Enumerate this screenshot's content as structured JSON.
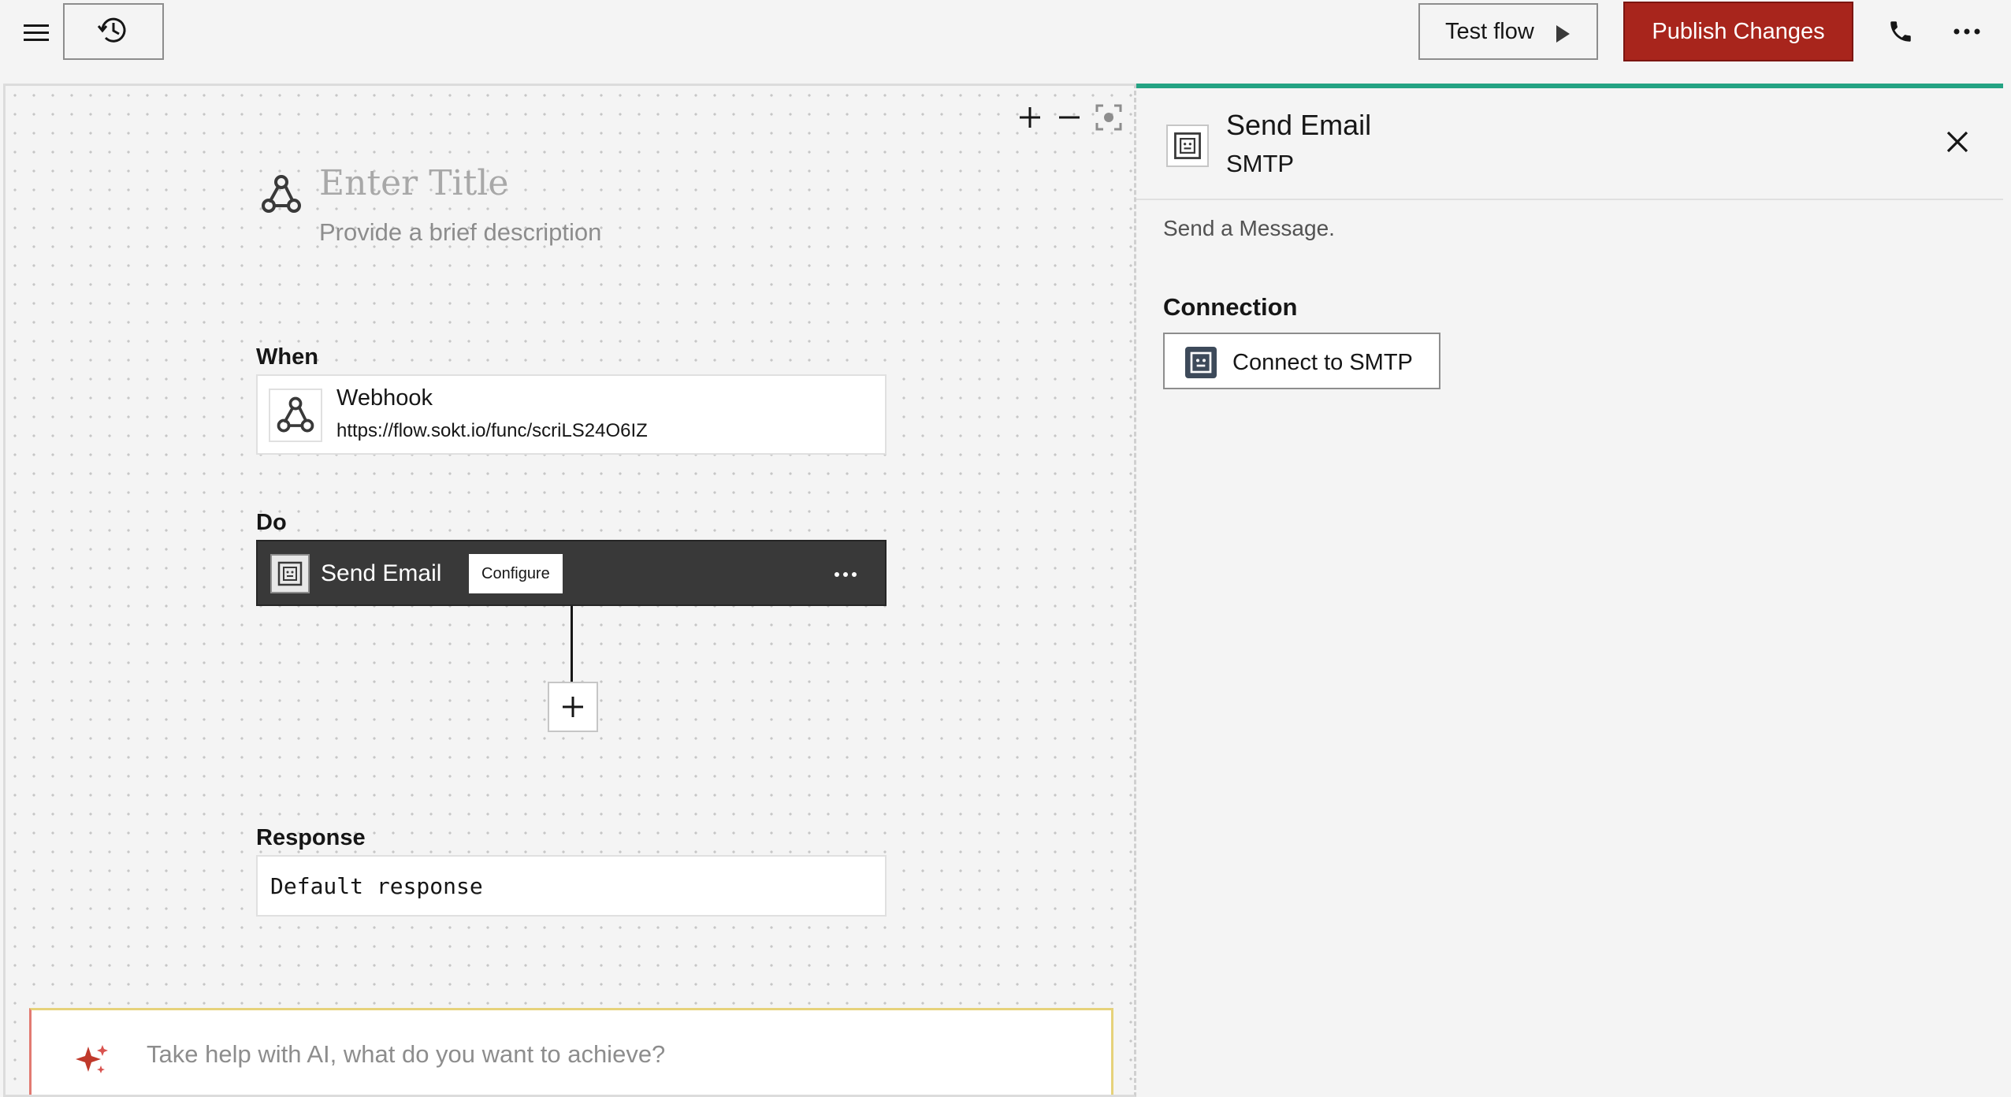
{
  "topbar": {
    "menu_icon": "hamburger-menu-icon",
    "history_icon": "history-icon",
    "test_flow_label": "Test flow",
    "publish_label": "Publish Changes",
    "publish_color": "#a8251c",
    "phone_icon": "phone-icon",
    "more_icon": "overflow-menu-icon"
  },
  "canvas": {
    "zoom_in_icon": "zoom-in-icon",
    "zoom_out_icon": "zoom-out-icon",
    "fit_icon": "fit-to-screen-icon",
    "title_placeholder": "Enter Title",
    "description_placeholder": "Provide a brief description",
    "when_label": "When",
    "trigger": {
      "name": "Webhook",
      "url": "https://flow.sokt.io/func/scriLS24O6IZ"
    },
    "do_label": "Do",
    "action": {
      "name": "Send Email",
      "configure_label": "Configure"
    },
    "response_label": "Response",
    "response_value": "Default response",
    "ai_placeholder": "Take help with AI, what do you want to achieve?"
  },
  "panel": {
    "accent_color": "#24a383",
    "title": "Send Email",
    "subtitle": "SMTP",
    "description": "Send a Message.",
    "connection_label": "Connection",
    "connect_button_label": "Connect to SMTP"
  }
}
